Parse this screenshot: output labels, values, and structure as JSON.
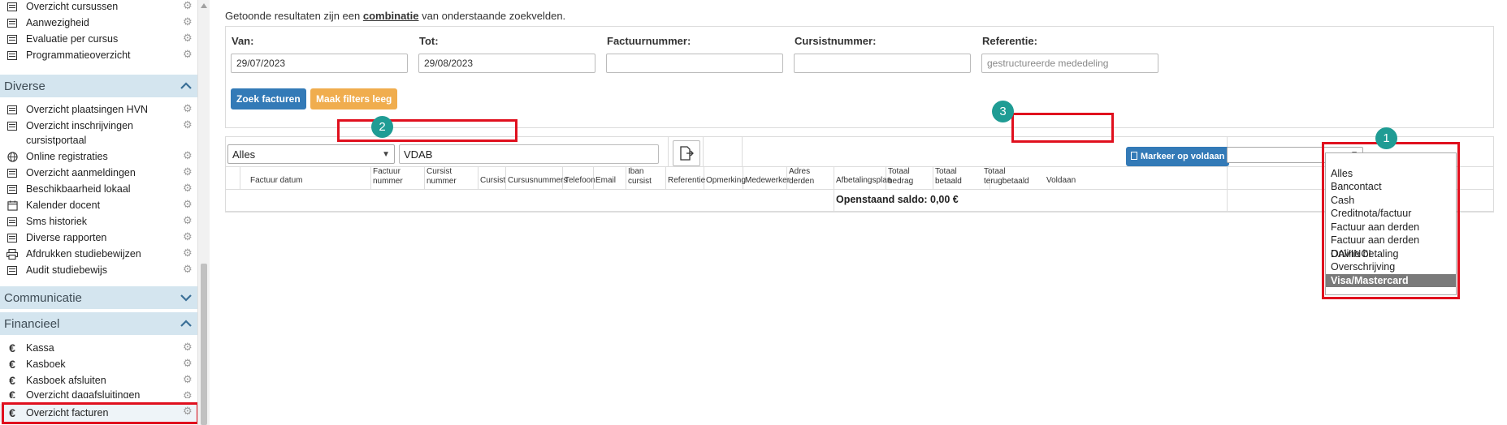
{
  "sidebar": {
    "items_top": [
      {
        "label": "Overzicht cursussen",
        "icon": "list-icon"
      },
      {
        "label": "Aanwezigheid",
        "icon": "list-icon"
      },
      {
        "label": "Evaluatie per cursus",
        "icon": "list-icon"
      },
      {
        "label": "Programmatieoverzicht",
        "icon": "list-icon"
      }
    ],
    "section_diverse": "Diverse",
    "items_diverse": [
      {
        "label": "Overzicht plaatsingen HVN",
        "icon": "list-icon"
      },
      {
        "label": "Overzicht inschrijvingen",
        "icon": "list-icon"
      },
      {
        "label": "cursistportaal",
        "icon": ""
      },
      {
        "label": "Online registraties",
        "icon": "globe-icon"
      },
      {
        "label": "Overzicht aanmeldingen",
        "icon": "list-icon"
      },
      {
        "label": "Beschikbaarheid lokaal",
        "icon": "list-icon"
      },
      {
        "label": "Kalender docent",
        "icon": "calendar-icon"
      },
      {
        "label": "Sms historiek",
        "icon": "list-icon"
      },
      {
        "label": "Diverse rapporten",
        "icon": "list-icon"
      },
      {
        "label": "Afdrukken studiebewijzen",
        "icon": "printer-icon"
      },
      {
        "label": "Audit studiebewijs",
        "icon": "list-icon"
      }
    ],
    "section_communicatie": "Communicatie",
    "section_financieel": "Financieel",
    "items_financieel": [
      {
        "label": "Kassa",
        "icon": "euro-icon"
      },
      {
        "label": "Kasboek",
        "icon": "euro-icon"
      },
      {
        "label": "Kasboek afsluiten",
        "icon": "euro-icon"
      },
      {
        "label": "Overzicht dagafsluitingen",
        "icon": "euro-icon"
      },
      {
        "label": "Overzicht facturen",
        "icon": "euro-icon"
      }
    ],
    "euro_symbol": "€",
    "gear_symbol": "⚙"
  },
  "info": {
    "before": "Getoonde resultaten zijn een ",
    "bold": "combinatie",
    "after": " van onderstaande zoekvelden."
  },
  "filters": {
    "van_label": "Van:",
    "van_value": "29/07/2023",
    "tot_label": "Tot:",
    "tot_value": "29/08/2023",
    "factuurnummer_label": "Factuurnummer:",
    "cursistnummer_label": "Cursistnummer:",
    "referentie_label": "Referentie:",
    "referentie_placeholder": "gestructureerde mededeling",
    "search_button": "Zoek facturen",
    "clear_button": "Maak filters leeg"
  },
  "results": {
    "status_select": "Alles",
    "search_value": "VDAB",
    "mark_paid_button": "Markeer op voldaan",
    "columns": [
      "Factuur datum",
      "Factuur nummer",
      "Cursist nummer",
      "Cursist",
      "Cursusnummers",
      "Telefoon",
      "Email",
      "Iban cursist",
      "Referentie",
      "Opmerking",
      "Medewerker",
      "Adres derden",
      "Afbetalingsplan",
      "Totaal bedrag",
      "Totaal betaald",
      "Totaal terugbetaald",
      "Voldaan"
    ],
    "balance": "Openstaand saldo: 0,00 €"
  },
  "payment_dropdown": {
    "options": [
      "",
      "Alles",
      "Bancontact",
      "Cash",
      "Creditnota/factuur",
      "Factuur aan derden",
      "Factuur aan derden DAVINCI",
      "Online betaling",
      "Overschrijving",
      "Visa/Mastercard"
    ],
    "selected": "Visa/Mastercard"
  },
  "annotations": {
    "badge1": "1",
    "badge2": "2",
    "badge3": "3"
  },
  "colors": {
    "sidebar_header": "#d4e5ef",
    "primary": "#337ab7",
    "warning": "#f0ad4e",
    "highlight": "#e0101e",
    "badge": "#1f9c94"
  }
}
